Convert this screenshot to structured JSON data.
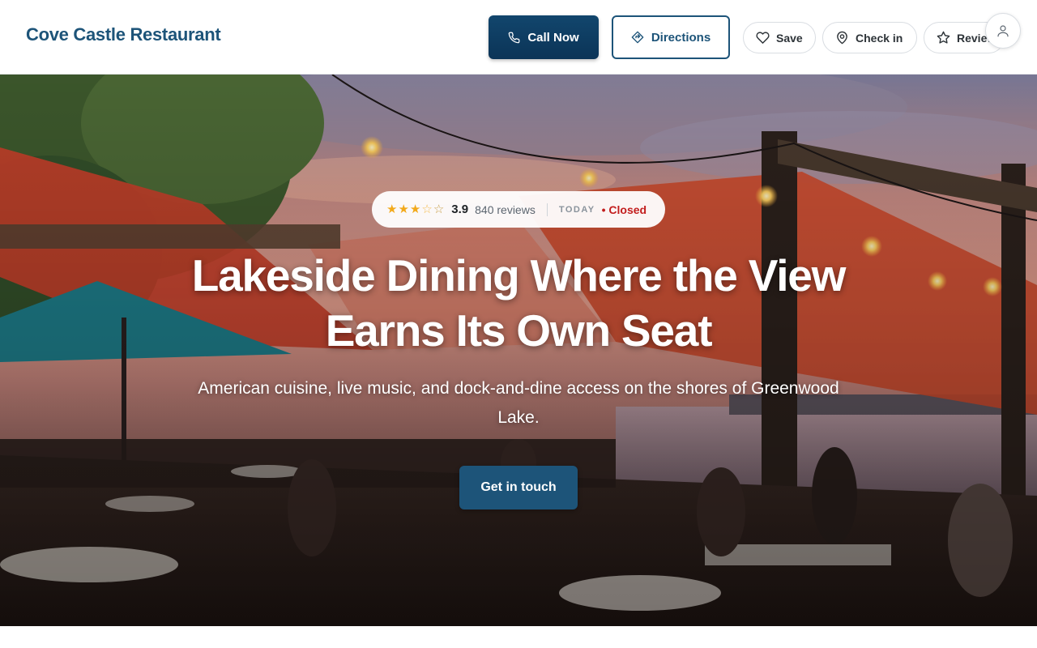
{
  "header": {
    "brand": "Cove Castle Restaurant",
    "call_label": "Call Now",
    "directions_label": "Directions",
    "save_label": "Save",
    "checkin_label": "Check in",
    "review_label": "Review",
    "call_icon": "phone-icon",
    "directions_icon": "directions-icon",
    "save_icon": "heart-icon",
    "checkin_icon": "map-pin-icon",
    "review_icon": "star-icon",
    "account_icon": "user-icon"
  },
  "hero": {
    "rating": {
      "stars_filled": 3,
      "stars_half": 1,
      "stars_total": 5,
      "score": "3.9",
      "reviews": "840 reviews",
      "today_label": "TODAY",
      "status": "Closed"
    },
    "title": "Lakeside Dining Where the View Earns Its Own Seat",
    "subtitle": "American cuisine, live music, and dock-and-dine access on the shores of Greenwood Lake.",
    "cta_label": "Get in touch"
  },
  "colors": {
    "brand": "#1d5479",
    "primary_dark": "#0b3457",
    "status_closed": "#c21d1d",
    "star": "#f2a91a"
  }
}
